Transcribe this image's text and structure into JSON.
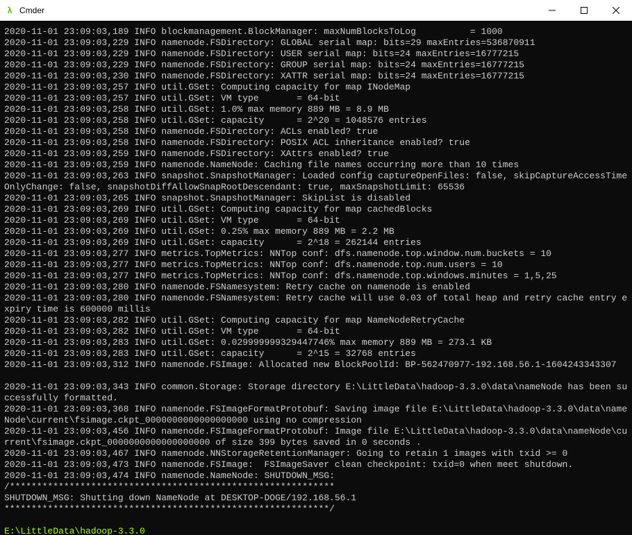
{
  "window": {
    "title": "Cmder",
    "icon_glyph": "λ"
  },
  "log_lines": [
    "2020-11-01 23:09:03,189 INFO blockmanagement.BlockManager: maxNumBlocksToLog          = 1000",
    "2020-11-01 23:09:03,229 INFO namenode.FSDirectory: GLOBAL serial map: bits=29 maxEntries=536870911",
    "2020-11-01 23:09:03,229 INFO namenode.FSDirectory: USER serial map: bits=24 maxEntries=16777215",
    "2020-11-01 23:09:03,229 INFO namenode.FSDirectory: GROUP serial map: bits=24 maxEntries=16777215",
    "2020-11-01 23:09:03,230 INFO namenode.FSDirectory: XATTR serial map: bits=24 maxEntries=16777215",
    "2020-11-01 23:09:03,257 INFO util.GSet: Computing capacity for map INodeMap",
    "2020-11-01 23:09:03,257 INFO util.GSet: VM type       = 64-bit",
    "2020-11-01 23:09:03,258 INFO util.GSet: 1.0% max memory 889 MB = 8.9 MB",
    "2020-11-01 23:09:03,258 INFO util.GSet: capacity      = 2^20 = 1048576 entries",
    "2020-11-01 23:09:03,258 INFO namenode.FSDirectory: ACLs enabled? true",
    "2020-11-01 23:09:03,258 INFO namenode.FSDirectory: POSIX ACL inheritance enabled? true",
    "2020-11-01 23:09:03,259 INFO namenode.FSDirectory: XAttrs enabled? true",
    "2020-11-01 23:09:03,259 INFO namenode.NameNode: Caching file names occurring more than 10 times",
    "2020-11-01 23:09:03,263 INFO snapshot.SnapshotManager: Loaded config captureOpenFiles: false, skipCaptureAccessTimeOnlyChange: false, snapshotDiffAllowSnapRootDescendant: true, maxSnapshotLimit: 65536",
    "2020-11-01 23:09:03,265 INFO snapshot.SnapshotManager: SkipList is disabled",
    "2020-11-01 23:09:03,269 INFO util.GSet: Computing capacity for map cachedBlocks",
    "2020-11-01 23:09:03,269 INFO util.GSet: VM type       = 64-bit",
    "2020-11-01 23:09:03,269 INFO util.GSet: 0.25% max memory 889 MB = 2.2 MB",
    "2020-11-01 23:09:03,269 INFO util.GSet: capacity      = 2^18 = 262144 entries",
    "2020-11-01 23:09:03,277 INFO metrics.TopMetrics: NNTop conf: dfs.namenode.top.window.num.buckets = 10",
    "2020-11-01 23:09:03,277 INFO metrics.TopMetrics: NNTop conf: dfs.namenode.top.num.users = 10",
    "2020-11-01 23:09:03,277 INFO metrics.TopMetrics: NNTop conf: dfs.namenode.top.windows.minutes = 1,5,25",
    "2020-11-01 23:09:03,280 INFO namenode.FSNamesystem: Retry cache on namenode is enabled",
    "2020-11-01 23:09:03,280 INFO namenode.FSNamesystem: Retry cache will use 0.03 of total heap and retry cache entry expiry time is 600000 millis",
    "2020-11-01 23:09:03,282 INFO util.GSet: Computing capacity for map NameNodeRetryCache",
    "2020-11-01 23:09:03,282 INFO util.GSet: VM type       = 64-bit",
    "2020-11-01 23:09:03,283 INFO util.GSet: 0.029999999329447746% max memory 889 MB = 273.1 KB",
    "2020-11-01 23:09:03,283 INFO util.GSet: capacity      = 2^15 = 32768 entries",
    "2020-11-01 23:09:03,312 INFO namenode.FSImage: Allocated new BlockPoolId: BP-562470977-192.168.56.1-1604243343307"
  ],
  "log_lines2": [
    "2020-11-01 23:09:03,343 INFO common.Storage: Storage directory E:\\LittleData\\hadoop-3.3.0\\data\\nameNode has been successfully formatted.",
    "2020-11-01 23:09:03,368 INFO namenode.FSImageFormatProtobuf: Saving image file E:\\LittleData\\hadoop-3.3.0\\data\\nameNode\\current\\fsimage.ckpt_0000000000000000000 using no compression",
    "2020-11-01 23:09:03,456 INFO namenode.FSImageFormatProtobuf: Image file E:\\LittleData\\hadoop-3.3.0\\data\\nameNode\\current\\fsimage.ckpt_0000000000000000000 of size 399 bytes saved in 0 seconds .",
    "2020-11-01 23:09:03,467 INFO namenode.NNStorageRetentionManager: Going to retain 1 images with txid >= 0",
    "2020-11-01 23:09:03,473 INFO namenode.FSImage:  FSImageSaver clean checkpoint: txid=0 when meet shutdown.",
    "2020-11-01 23:09:03,474 INFO namenode.NameNode: SHUTDOWN_MSG:",
    "/************************************************************",
    "SHUTDOWN_MSG: Shutting down NameNode at DESKTOP-DOGE/192.168.56.1",
    "************************************************************/"
  ],
  "prompt": "E:\\LittleData\\hadoop-3.3.0"
}
